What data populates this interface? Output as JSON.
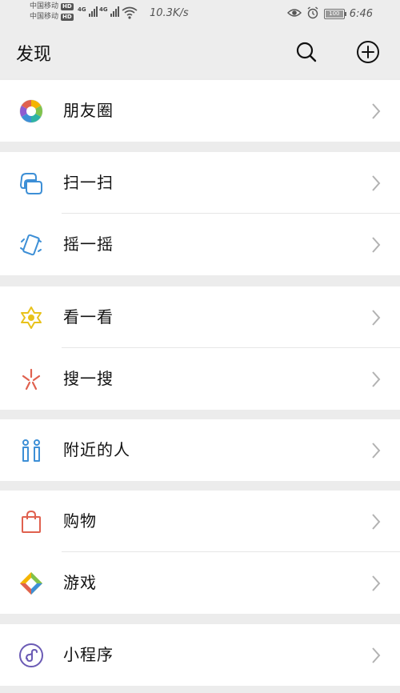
{
  "status": {
    "carrier1": "中国移动",
    "carrier2": "中国移动",
    "hd": "HD",
    "network1": "4G",
    "network2": "4G",
    "speed": "10.3K/s",
    "battery": "100",
    "time": "6:46"
  },
  "header": {
    "title": "发现",
    "search_icon": "search-icon",
    "add_icon": "plus-circle-icon"
  },
  "menu": {
    "moments": "朋友圈",
    "scan": "扫一扫",
    "shake": "摇一摇",
    "top_stories": "看一看",
    "search": "搜一搜",
    "nearby": "附近的人",
    "shopping": "购物",
    "games": "游戏",
    "mini_programs": "小程序"
  },
  "colors": {
    "background": "#ececec",
    "card": "#ffffff",
    "blue_icon": "#3d8fd6",
    "yellow_icon": "#e8c21b",
    "red_icon": "#e0614f",
    "purple_icon": "#6b5bb5",
    "chevron": "#b2b2b2"
  }
}
